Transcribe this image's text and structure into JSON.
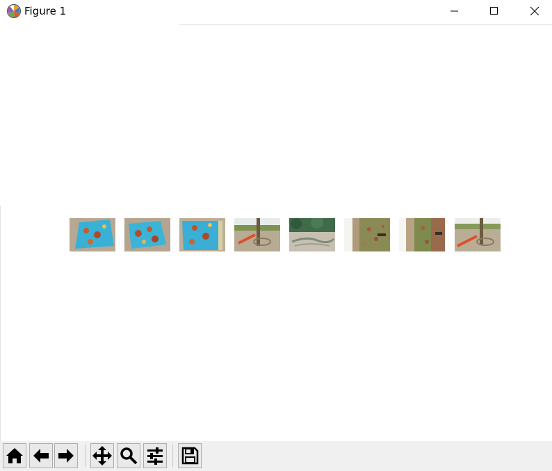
{
  "window": {
    "title": "Figure 1",
    "controls": [
      "minimize",
      "maximize",
      "close"
    ]
  },
  "figure": {
    "images": [
      {
        "name": "fabric-bag-1",
        "colors": [
          "#3fb3d6",
          "#b8a488",
          "#c0552a"
        ]
      },
      {
        "name": "fabric-bag-2",
        "colors": [
          "#3fb3d6",
          "#b8a488",
          "#c0552a"
        ]
      },
      {
        "name": "fabric-bag-3",
        "colors": [
          "#3fb3d6",
          "#b8a488",
          "#c0552a"
        ]
      },
      {
        "name": "tree-orange-shovel-1",
        "colors": [
          "#8a9a5a",
          "#b7ab94",
          "#d85a2a"
        ]
      },
      {
        "name": "ground-pine-branches",
        "colors": [
          "#3e6a4a",
          "#c9c2b4",
          "#888f80"
        ]
      },
      {
        "name": "rotated-tree-scene-1",
        "colors": [
          "#7c8a4a",
          "#a46b4e",
          "#ffffff"
        ]
      },
      {
        "name": "rotated-tree-scene-2",
        "colors": [
          "#7c8a4a",
          "#a46b4e",
          "#ffffff"
        ]
      },
      {
        "name": "tree-orange-shovel-2",
        "colors": [
          "#8a9a5a",
          "#b7ab94",
          "#d85a2a"
        ]
      }
    ]
  },
  "toolbar": {
    "buttons": [
      "home",
      "back",
      "forward",
      "pan",
      "zoom",
      "configure-subplots",
      "save"
    ]
  }
}
